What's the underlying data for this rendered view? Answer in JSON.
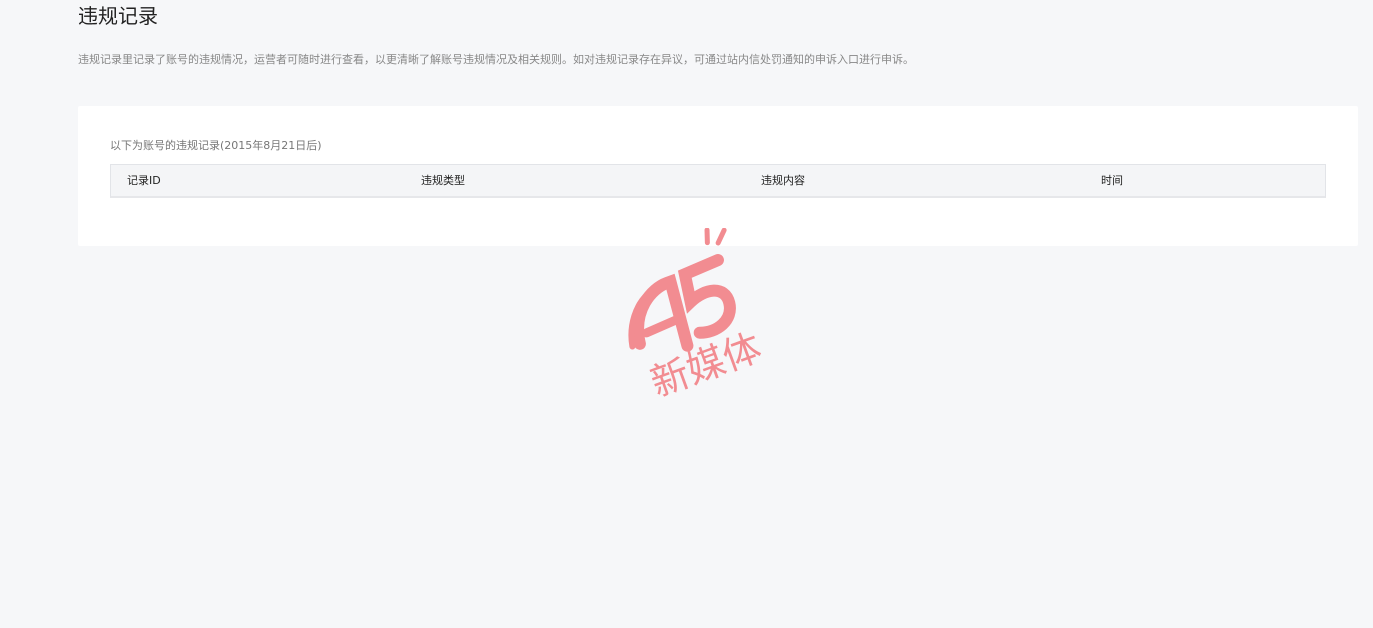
{
  "page": {
    "title": "违规记录",
    "description": "违规记录里记录了账号的违规情况，运营者可随时进行查看，以更清晰了解账号违规情况及相关规则。如对违规记录存在异议，可通过站内信处罚通知的申诉入口进行申诉。"
  },
  "records": {
    "subtitle": "以下为账号的违规记录(2015年8月21日后)",
    "columns": [
      "记录ID",
      "违规类型",
      "违规内容",
      "时间"
    ],
    "rows": []
  },
  "watermark": {
    "logo_text": "A5",
    "text": "新媒体",
    "color": "#f2797f"
  }
}
